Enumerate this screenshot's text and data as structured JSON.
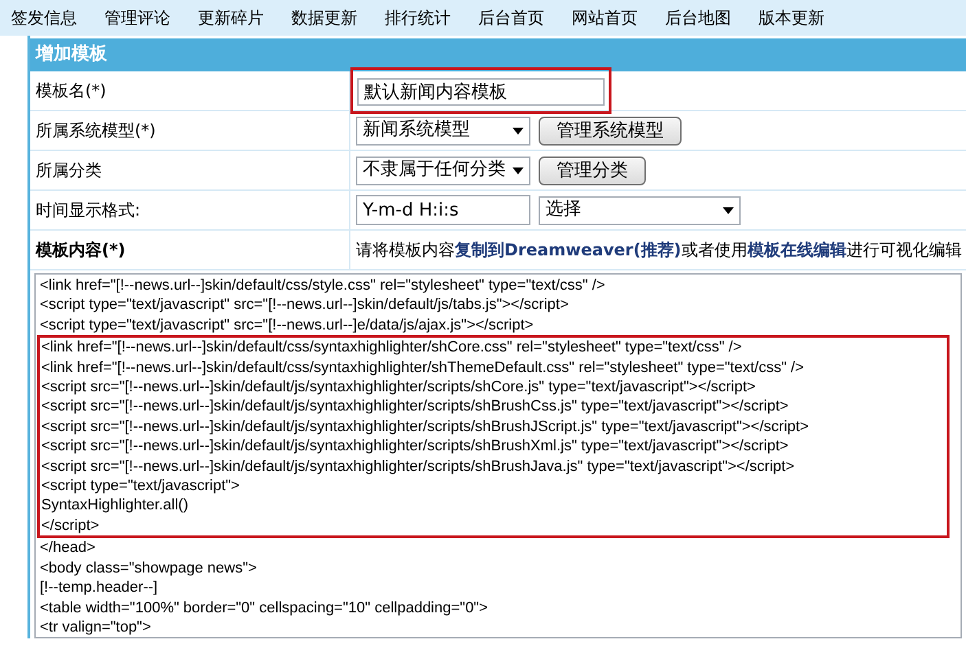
{
  "nav": [
    "签发信息",
    "管理评论",
    "更新碎片",
    "数据更新",
    "排行统计",
    "后台首页",
    "网站首页",
    "后台地图",
    "版本更新"
  ],
  "panel_title": "增加模板",
  "rows": [
    {
      "kind": "input",
      "label": "模板名(*)",
      "value": "默认新闻内容模板",
      "highlighted": true
    },
    {
      "kind": "select",
      "label": "所属系统模型(*)",
      "value": "新闻系统模型",
      "button": "管理系统模型"
    },
    {
      "kind": "select",
      "label": "所属分类",
      "value": "不隶属于任何分类",
      "button": "管理分类"
    },
    {
      "kind": "format",
      "label": "时间显示格式:",
      "value": "Y-m-d H:i:s",
      "select": "选择"
    },
    {
      "kind": "note",
      "label": "模板内容(*)",
      "text": "请将模板内容**复制到Dreamweaver(推荐)**或者使用**模板在线编辑**进行可视化编辑"
    }
  ],
  "code_lines": [
    {
      "text": "<link href=\"[!--news.url--]skin/default/css/style.css\" rel=\"stylesheet\" type=\"text/css\" />",
      "highlighted": false
    },
    {
      "text": "<script type=\"text/javascript\" src=\"[!--news.url--]skin/default/js/tabs.js\"></script>",
      "highlighted": false
    },
    {
      "text": "<script type=\"text/javascript\" src=\"[!--news.url--]e/data/js/ajax.js\"></script>",
      "highlighted": false
    },
    {
      "text": "<link href=\"[!--news.url--]skin/default/css/syntaxhighlighter/shCore.css\" rel=\"stylesheet\" type=\"text/css\" />",
      "highlighted": true
    },
    {
      "text": "<link href=\"[!--news.url--]skin/default/css/syntaxhighlighter/shThemeDefault.css\" rel=\"stylesheet\" type=\"text/css\" />",
      "highlighted": true
    },
    {
      "text": "<script src=\"[!--news.url--]skin/default/js/syntaxhighlighter/scripts/shCore.js\" type=\"text/javascript\"></script>",
      "highlighted": true
    },
    {
      "text": "<script src=\"[!--news.url--]skin/default/js/syntaxhighlighter/scripts/shBrushCss.js\" type=\"text/javascript\"></script>",
      "highlighted": true
    },
    {
      "text": "<script src=\"[!--news.url--]skin/default/js/syntaxhighlighter/scripts/shBrushJScript.js\" type=\"text/javascript\"></script>",
      "highlighted": true
    },
    {
      "text": "<script src=\"[!--news.url--]skin/default/js/syntaxhighlighter/scripts/shBrushXml.js\" type=\"text/javascript\"></script>",
      "highlighted": true
    },
    {
      "text": "<script src=\"[!--news.url--]skin/default/js/syntaxhighlighter/scripts/shBrushJava.js\" type=\"text/javascript\"></script>",
      "highlighted": true
    },
    {
      "text": "<script type=\"text/javascript\">",
      "highlighted": true
    },
    {
      "text": "SyntaxHighlighter.all()",
      "highlighted": true
    },
    {
      "text": "</script>",
      "highlighted": true
    },
    {
      "text": "</head>",
      "highlighted": false
    },
    {
      "text": "<body class=\"showpage news\">",
      "highlighted": false
    },
    {
      "text": "[!--temp.header--]",
      "highlighted": false
    },
    {
      "text": "<table width=\"100%\" border=\"0\" cellspacing=\"10\" cellpadding=\"0\">",
      "highlighted": false
    },
    {
      "text": "<tr valign=\"top\">",
      "highlighted": false
    }
  ]
}
